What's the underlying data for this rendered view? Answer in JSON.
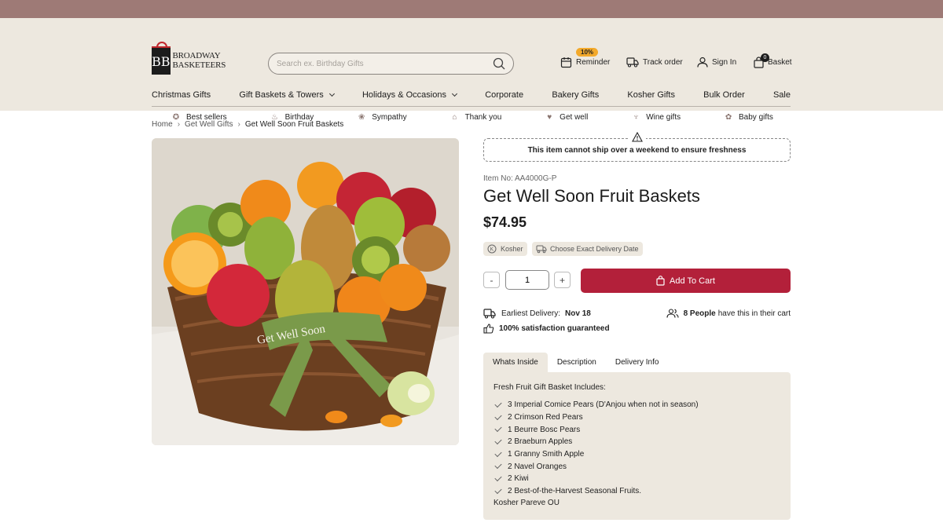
{
  "brand": {
    "logo_text_line1": "BROADWAY",
    "logo_text_line2": "BASKETEERS",
    "logo_mark": "BB"
  },
  "search": {
    "placeholder": "Search ex. Birthday Gifts"
  },
  "header_actions": {
    "reminder_badge": "10%",
    "reminder": "Reminder",
    "track_order": "Track order",
    "sign_in": "Sign In",
    "basket": "Basket",
    "basket_count": "0"
  },
  "main_nav": [
    {
      "label": "Christmas Gifts"
    },
    {
      "label": "Gift Baskets & Towers"
    },
    {
      "label": "Holidays & Occasions"
    },
    {
      "label": "Corporate"
    },
    {
      "label": "Bakery Gifts"
    },
    {
      "label": "Kosher Gifts"
    },
    {
      "label": "Bulk Order"
    },
    {
      "label": "Sale"
    }
  ],
  "sub_nav": [
    {
      "label": "Best sellers",
      "icon": "medal-icon"
    },
    {
      "label": "Birthday",
      "icon": "cake-icon"
    },
    {
      "label": "Sympathy",
      "icon": "flower-icon"
    },
    {
      "label": "Thank you",
      "icon": "gift-icon"
    },
    {
      "label": "Get well",
      "icon": "heart-icon"
    },
    {
      "label": "Wine gifts",
      "icon": "wine-icon"
    },
    {
      "label": "Baby gifts",
      "icon": "baby-icon"
    }
  ],
  "breadcrumb": {
    "home": "Home",
    "category": "Get Well Gifts",
    "current": "Get Well Soon Fruit Baskets"
  },
  "product": {
    "shipping_notice": "This item cannot ship over a weekend to ensure freshness",
    "item_no": "Item No: AA4000G-P",
    "title": "Get Well Soon Fruit Baskets",
    "price": "$74.95",
    "tag_kosher": "Kosher",
    "tag_delivery_date": "Choose Exact Delivery Date",
    "quantity": "1",
    "qty_minus": "-",
    "qty_plus": "+",
    "add_to_cart": "Add To Cart",
    "earliest_delivery_label": "Earliest Delivery:",
    "earliest_delivery_date": "Nov 18",
    "satisfaction": "100% satisfaction guaranteed",
    "in_cart_count": "8 People",
    "in_cart_text": "have this in their cart",
    "image_ribbon_text": "Get Well Soon"
  },
  "tabs": [
    {
      "label": "Whats Inside",
      "active": true
    },
    {
      "label": "Description",
      "active": false
    },
    {
      "label": "Delivery Info",
      "active": false
    }
  ],
  "whats_inside": {
    "intro": "Fresh Fruit Gift Basket Includes:",
    "items": [
      "3 Imperial Comice Pears (D'Anjou when not in season)",
      "2 Crimson Red Pears",
      "1 Beurre Bosc Pears",
      "2 Braeburn Apples",
      "1 Granny Smith Apple",
      "2 Navel Oranges",
      "2 Kiwi",
      "2 Best-of-the-Harvest Seasonal Fruits."
    ],
    "footer": "Kosher Pareve OU"
  },
  "colors": {
    "top_bar": "#9e7a76",
    "header_bg": "#ede8df",
    "accent": "#b3203a",
    "badge": "#f3a92b"
  }
}
